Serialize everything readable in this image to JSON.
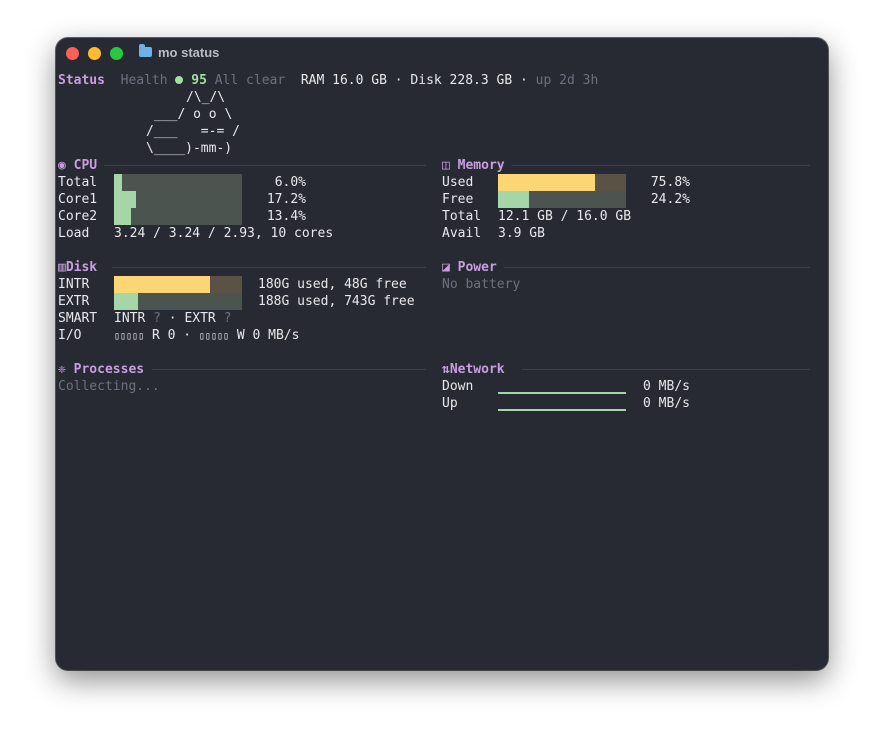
{
  "window": {
    "title": "mo status"
  },
  "status_line": {
    "status_label": "Status",
    "health_label": "Health",
    "health_score": "95",
    "health_text": "All clear",
    "ram": "RAM 16.0 GB",
    "sep1": "·",
    "disk": "Disk 228.3 GB",
    "sep2": "·",
    "uptime": "up 2d 3h"
  },
  "mascot": {
    "line1": "/\\_/\\",
    "line2": "___/ o o \\",
    "line3": "/___   =-= /",
    "line4": "\\____)-mm-)"
  },
  "cpu": {
    "icon": "◉",
    "title": "CPU",
    "rows": [
      {
        "label": "Total",
        "value": "6.0%",
        "fraction": 0.06
      },
      {
        "label": "Core1",
        "value": "17.2%",
        "fraction": 0.172
      },
      {
        "label": "Core2",
        "value": "13.4%",
        "fraction": 0.134
      }
    ],
    "load_label": "Load",
    "load_value": "3.24 / 3.24 / 2.93, 10 cores"
  },
  "memory": {
    "icon": "◫",
    "title": "Memory",
    "used_label": "Used",
    "used_value": "75.8%",
    "used_fraction": 0.758,
    "free_label": "Free",
    "free_value": "24.2%",
    "free_fraction": 0.242,
    "total_label": "Total",
    "total_value": "12.1 GB / 16.0 GB",
    "avail_label": "Avail",
    "avail_value": "3.9 GB"
  },
  "disk": {
    "icon": "▥",
    "title": "Disk",
    "rows": [
      {
        "label": "INTR",
        "value": "180G used, 48G free",
        "fraction": 0.75
      },
      {
        "label": "EXTR",
        "value": "188G used, 743G free",
        "fraction": 0.19
      }
    ],
    "smart_label": "SMART",
    "smart_intr": "INTR",
    "smart_q1": "?",
    "smart_sep": "·",
    "smart_extr": "EXTR",
    "smart_q2": "?",
    "io_label": "I/O",
    "io_read_spark": "▯▯▯▯▯",
    "io_read": "R 0",
    "io_sep": "·",
    "io_write_spark": "▯▯▯▯▯",
    "io_write": "W 0 MB/s"
  },
  "power": {
    "icon": "◪",
    "title": "Power",
    "text": "No battery"
  },
  "processes": {
    "icon": "❈",
    "title": "Processes",
    "text": "Collecting..."
  },
  "network": {
    "icon": "⇅",
    "title": "Network",
    "down_label": "Down",
    "down_value": "0 MB/s",
    "up_label": "Up",
    "up_value": "0 MB/s"
  },
  "colors": {
    "bar_green": "#a5d6a7",
    "bar_yellow": "#fcd574",
    "accent_purple": "#c79fe0",
    "health_green": "#9fe19f"
  }
}
